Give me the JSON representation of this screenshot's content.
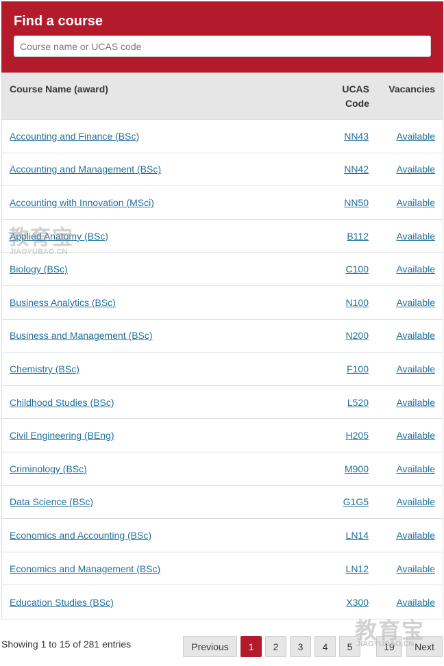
{
  "header": {
    "title": "Find a course",
    "search_placeholder": "Course name or UCAS code",
    "search_value": ""
  },
  "table": {
    "columns": {
      "name": "Course Name (award)",
      "code_line1": "UCAS",
      "code_line2": "Code",
      "vacancies": "Vacancies"
    },
    "rows": [
      {
        "name": "Accounting and Finance (BSc)",
        "code": "NN43",
        "vacancies": "Available"
      },
      {
        "name": "Accounting and Management (BSc)",
        "code": "NN42",
        "vacancies": "Available"
      },
      {
        "name": "Accounting with Innovation (MSci)",
        "code": "NN50",
        "vacancies": "Available"
      },
      {
        "name": "Applied Anatomy (BSc)",
        "code": "B112",
        "vacancies": "Available"
      },
      {
        "name": "Biology (BSc)",
        "code": "C100",
        "vacancies": "Available"
      },
      {
        "name": "Business Analytics (BSc)",
        "code": "N100",
        "vacancies": "Available"
      },
      {
        "name": "Business and Management (BSc)",
        "code": "N200",
        "vacancies": "Available"
      },
      {
        "name": "Chemistry (BSc)",
        "code": "F100",
        "vacancies": "Available"
      },
      {
        "name": "Childhood Studies (BSc)",
        "code": "L520",
        "vacancies": "Available"
      },
      {
        "name": "Civil Engineering (BEng)",
        "code": "H205",
        "vacancies": "Available"
      },
      {
        "name": "Criminology (BSc)",
        "code": "M900",
        "vacancies": "Available"
      },
      {
        "name": "Data Science (BSc)",
        "code": "G1G5",
        "vacancies": "Available"
      },
      {
        "name": "Economics and Accounting (BSc)",
        "code": "LN14",
        "vacancies": "Available"
      },
      {
        "name": "Economics and Management (BSc)",
        "code": "LN12",
        "vacancies": "Available"
      },
      {
        "name": "Education Studies (BSc)",
        "code": "X300",
        "vacancies": "Available"
      }
    ]
  },
  "footer": {
    "info": "Showing 1 to 15 of 281 entries",
    "previous": "Previous",
    "pages": [
      "1",
      "2",
      "3",
      "4",
      "5",
      "19"
    ],
    "next": "Next",
    "active_page": "1"
  },
  "watermark": {
    "cn": "教育宝",
    "en": "JIAOYUBAO.CN"
  },
  "colors": {
    "brand": "#b31b2d",
    "link": "#1f6f9c",
    "header_row": "#e6e6e6"
  }
}
